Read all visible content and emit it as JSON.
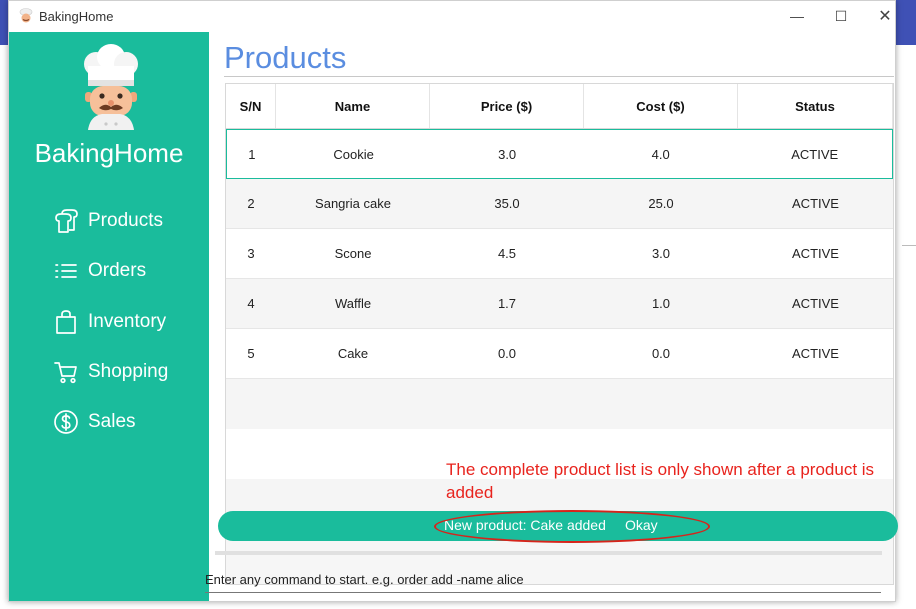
{
  "window": {
    "title": "BakingHome",
    "controls": {
      "minimize": "—",
      "maximize": "☐",
      "close": "✕"
    }
  },
  "sidebar": {
    "brand": "BakingHome",
    "items": [
      {
        "label": "Products",
        "icon": "bread-icon"
      },
      {
        "label": "Orders",
        "icon": "list-icon"
      },
      {
        "label": "Inventory",
        "icon": "bag-icon"
      },
      {
        "label": "Shopping",
        "icon": "cart-icon"
      },
      {
        "label": "Sales",
        "icon": "dollar-icon"
      }
    ]
  },
  "main": {
    "title": "Products",
    "table": {
      "columns": [
        "S/N",
        "Name",
        "Price ($)",
        "Cost ($)",
        "Status"
      ],
      "rows": [
        [
          "1",
          "Cookie",
          "3.0",
          "4.0",
          "ACTIVE"
        ],
        [
          "2",
          "Sangria cake",
          "35.0",
          "25.0",
          "ACTIVE"
        ],
        [
          "3",
          "Scone",
          "4.5",
          "3.0",
          "ACTIVE"
        ],
        [
          "4",
          "Waffle",
          "1.7",
          "1.0",
          "ACTIVE"
        ],
        [
          "5",
          "Cake",
          "0.0",
          "0.0",
          "ACTIVE"
        ]
      ]
    }
  },
  "snackbar": {
    "message": "New product: Cake added",
    "action": "Okay"
  },
  "annotation": {
    "text": "The complete product list is only shown after a product is added",
    "color": "#e8231d"
  },
  "command": {
    "placeholder": "Enter any command to start. e.g. order add -name alice"
  },
  "colors": {
    "accent": "#1abc9c",
    "title": "#5a8de0"
  }
}
